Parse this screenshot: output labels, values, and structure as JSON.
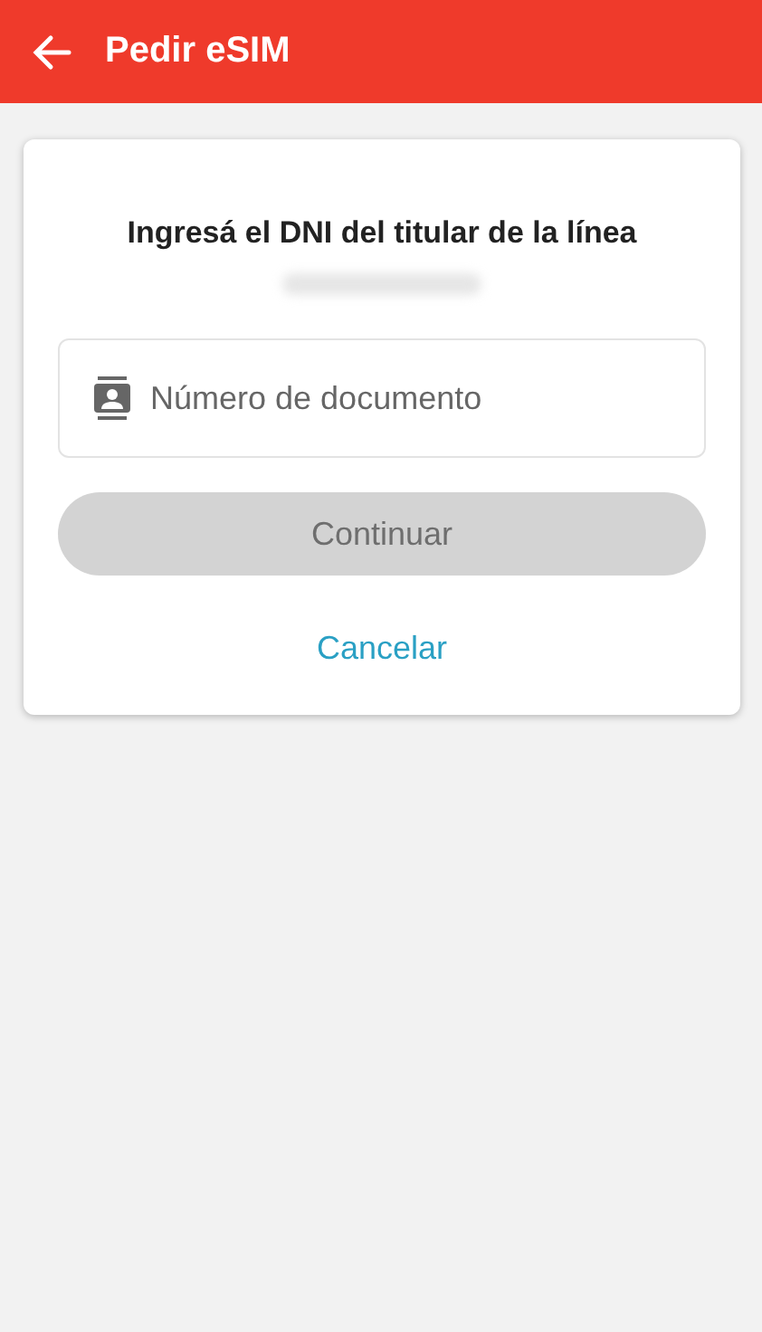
{
  "header": {
    "title": "Pedir eSIM"
  },
  "card": {
    "title": "Ingresá el DNI del titular de la línea",
    "field": {
      "placeholder": "Número de documento"
    },
    "continue_button": {
      "label": "Continuar",
      "disabled": true
    },
    "cancel_link": "Cancelar"
  }
}
